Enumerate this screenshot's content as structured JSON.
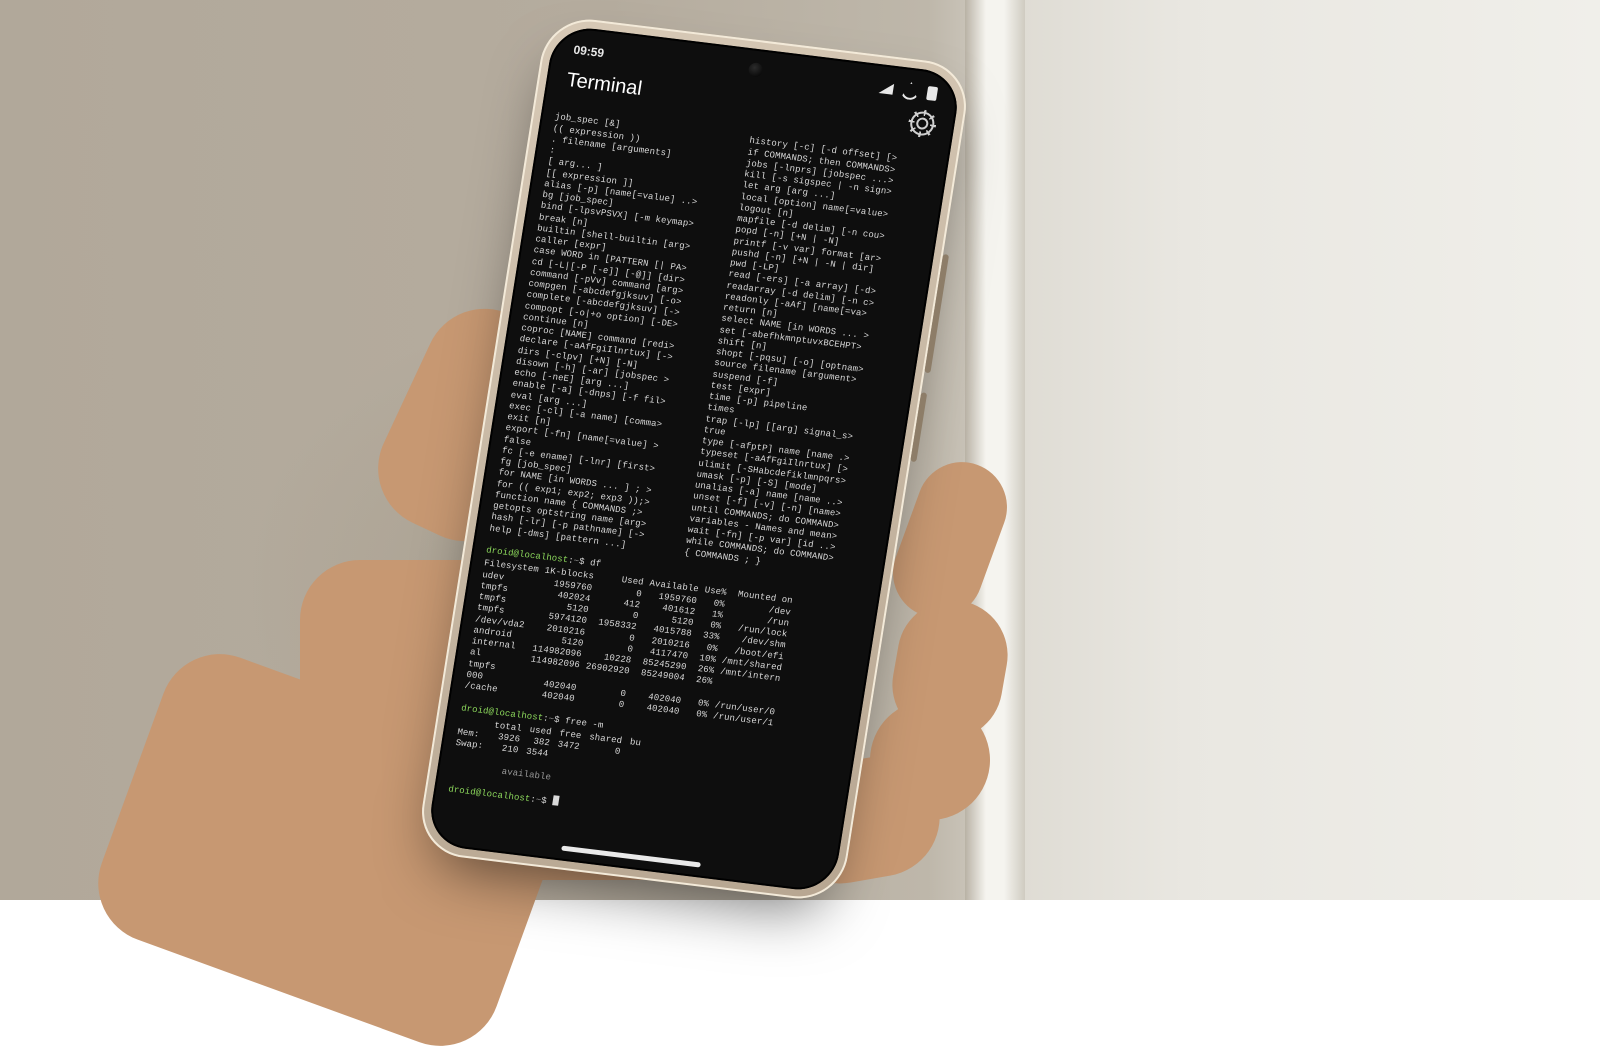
{
  "status_bar": {
    "time": "09:59",
    "icons": [
      "signal-icon",
      "wifi-icon",
      "battery-icon"
    ]
  },
  "app": {
    "title": "Terminal",
    "settings_label": "Settings"
  },
  "prompt": {
    "user": "droid",
    "host": "localhost",
    "cwd": "~",
    "symbol": "$"
  },
  "help_left": [
    "job_spec [&]",
    "(( expression ))",
    ". filename [arguments]",
    ":",
    "[ arg... ]",
    "[[ expression ]]",
    "alias [-p] [name[=value] ..>",
    "bg [job_spec]",
    "bind [-lpsvPSVX] [-m keymap>",
    "break [n]",
    "builtin [shell-builtin [arg>",
    "caller [expr]",
    "case WORD in [PATTERN [| PA>",
    "cd [-L|[-P [-e]] [-@]] [dir>",
    "command [-pVv] command [arg>",
    "compgen [-abcdefgjksuv] [-o>",
    "complete [-abcdefgjksuv] [->",
    "compopt [-o|+o option] [-DE>",
    "continue [n]",
    "coproc [NAME] command [redi>",
    "declare [-aAfFgiIlnrtux] [->",
    "dirs [-clpv] [+N] [-N]",
    "disown [-h] [-ar] [jobspec >",
    "echo [-neE] [arg ...]",
    "enable [-a] [-dnps] [-f fil>",
    "eval [arg ...]",
    "exec [-cl] [-a name] [comma>",
    "exit [n]",
    "export [-fn] [name[=value] >",
    "false",
    "fc [-e ename] [-lnr] [first>",
    "fg [job_spec]",
    "for NAME [in WORDS ... ] ; >",
    "for (( exp1; exp2; exp3 ));>",
    "function name { COMMANDS ;>",
    "getopts optstring name [arg>",
    "hash [-lr] [-p pathname] [->",
    "help [-dms] [pattern ...]"
  ],
  "help_right": [
    "history [-c] [-d offset] [>",
    "if COMMANDS; then COMMANDS>",
    "jobs [-lnprs] [jobspec ...>",
    "kill [-s sigspec | -n sign>",
    "let arg [arg ...]",
    "local [option] name[=value>",
    "logout [n]",
    "mapfile [-d delim] [-n cou>",
    "popd [-n] [+N | -N]",
    "printf [-v var] format [ar>",
    "pushd [-n] [+N | -N | dir]",
    "pwd [-LP]",
    "read [-ers] [-a array] [-d>",
    "readarray [-d delim] [-n c>",
    "readonly [-aAf] [name[=va>",
    "return [n]",
    "select NAME [in WORDS ... >",
    "set [-abefhkmnptuvxBCEHPT>",
    "shift [n]",
    "shopt [-pqsu] [-o] [optnam>",
    "source filename [argument>",
    "suspend [-f]",
    "test [expr]",
    "time [-p] pipeline",
    "times",
    "trap [-lp] [[arg] signal_s>",
    "true",
    "type [-afptP] name [name .>",
    "typeset [-aAfFgiIlnrtux] [>",
    "ulimit [-SHabcdefiklmnpqrs>",
    "umask [-p] [-S] [mode]",
    "unalias [-a] name [name ..>",
    "unset [-f] [-v] [-n] [name>",
    "until COMMANDS; do COMMAND>",
    "variables - Names and mean>",
    "wait [-fn] [-p var] [id ..>",
    "while COMMANDS; do COMMAND>",
    "{ COMMANDS ; }"
  ],
  "commands": {
    "df": "df",
    "free": "free -m"
  },
  "df": {
    "headers": [
      "Filesystem",
      "1K-blocks",
      "Used",
      "Available",
      "Use%",
      "Mounted on"
    ],
    "rows": [
      [
        "udev",
        "1959760",
        "0",
        "1959760",
        "0%",
        "/dev"
      ],
      [
        "tmpfs",
        "402024",
        "412",
        "401612",
        "1%",
        "/run"
      ],
      [
        "tmpfs",
        "5120",
        "0",
        "5120",
        "0%",
        "/run/lock"
      ],
      [
        "tmpfs",
        "5974120",
        "1958332",
        "4015788",
        "33%",
        "/dev/shm"
      ],
      [
        "/dev/vda2",
        "2010216",
        "0",
        "2010216",
        "0%",
        "/boot/efi"
      ],
      [
        "android",
        "5120",
        "0",
        "4117470",
        "10%",
        "/mnt/shared"
      ],
      [
        "internal",
        "114982096",
        "10228",
        "85245290",
        "26%",
        "/mnt/intern"
      ],
      [
        "al",
        "114982096",
        "26902920",
        "85249004",
        "26%",
        ""
      ],
      [
        "tmpfs",
        "",
        "",
        "",
        "",
        ""
      ],
      [
        "000",
        "402040",
        "0",
        "402040",
        "0%",
        "/run/user/0"
      ],
      [
        "/cache",
        "402040",
        "0",
        "402040",
        "0%",
        "/run/user/1"
      ]
    ]
  },
  "free": {
    "headers": [
      "",
      "total",
      "used",
      "free",
      "shared",
      "bu"
    ],
    "rows": [
      [
        "Mem:",
        "3926",
        "382",
        "3472",
        "0",
        ""
      ],
      [
        "Swap:",
        "210",
        "3544",
        "",
        "",
        ""
      ]
    ],
    "available_label": "available"
  }
}
